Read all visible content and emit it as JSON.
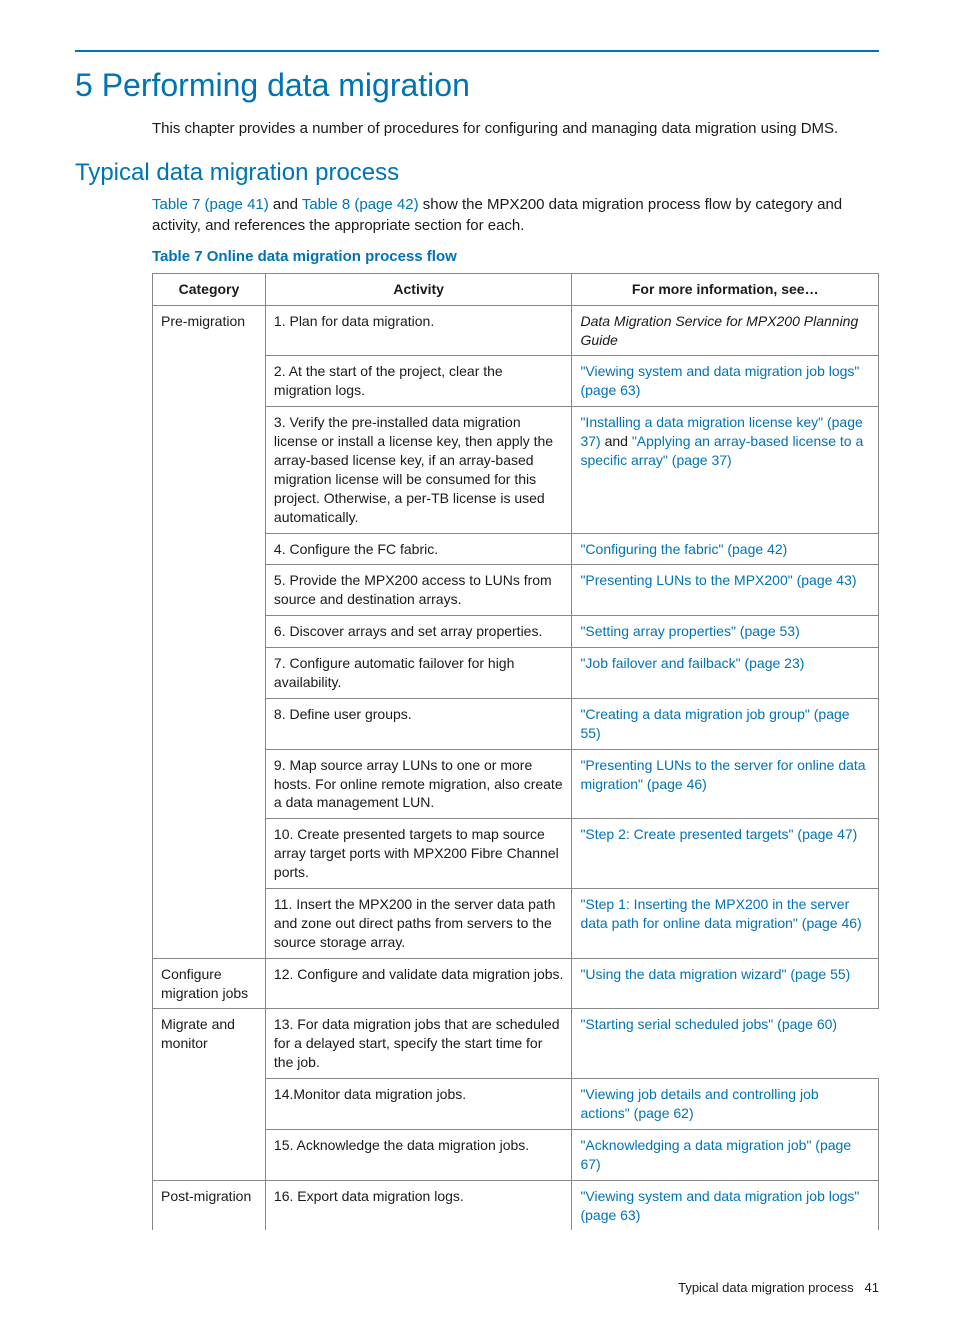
{
  "chapter_title": "5 Performing data migration",
  "chapter_intro": "This chapter provides a number of procedures for configuring and managing data migration using DMS.",
  "section_title": "Typical data migration process",
  "section_intro": {
    "link1": "Table 7 (page 41)",
    "mid1": " and ",
    "link2": "Table 8 (page 42)",
    "rest": " show the MPX200 data migration process flow by category and activity, and references the appropriate section for each."
  },
  "table_title": "Table 7 Online data migration process flow",
  "headers": {
    "c1": "Category",
    "c2": "Activity",
    "c3": "For more information, see…"
  },
  "rows": {
    "r1": {
      "cat": "Pre-migration",
      "act": "1. Plan for data migration.",
      "info_italic": "Data Migration Service for MPX200 Planning Guide"
    },
    "r2": {
      "act": "2. At the start of the project, clear the migration logs.",
      "link": "\"Viewing system and data migration job logs\" (page 63)"
    },
    "r3": {
      "act": "3. Verify the pre-installed data migration license or install a license key, then apply the array-based license key, if an array-based migration license will be consumed for this project. Otherwise, a per-TB license is used automatically.",
      "linkA": "\"Installing a data migration license key\" (page 37)",
      "mid": " and ",
      "linkB": "\"Applying an array-based license to a specific array\" (page 37)"
    },
    "r4": {
      "act": "4. Configure the FC fabric.",
      "link": "\"Configuring the fabric\" (page 42)"
    },
    "r5": {
      "act": "5. Provide the MPX200 access to LUNs from source and destination arrays.",
      "link": "\"Presenting LUNs to the MPX200\" (page 43)"
    },
    "r6": {
      "act": "6. Discover arrays and set array properties.",
      "link": "\"Setting array properties\" (page 53)"
    },
    "r7": {
      "act": "7. Configure automatic failover for high availability.",
      "link": "\"Job failover and failback\" (page 23)"
    },
    "r8": {
      "act": "8. Define user groups.",
      "link": "\"Creating a data migration job group\" (page 55)"
    },
    "r9": {
      "act": "9. Map source array LUNs to one or more hosts. For online remote migration, also create a data management LUN.",
      "link": "\"Presenting LUNs to the server for online data migration\" (page 46)"
    },
    "r10": {
      "act": "10. Create presented targets to map source array target ports with MPX200 Fibre Channel ports.",
      "link": "\"Step 2: Create presented targets\" (page 47)"
    },
    "r11": {
      "act": "11. Insert the MPX200 in the server data path and zone out direct paths from servers to the source storage array.",
      "link": "\"Step 1: Inserting the MPX200 in the server data path for online data migration\" (page 46)"
    },
    "r12": {
      "cat": "Configure migration jobs",
      "act": "12. Configure and validate data migration jobs.",
      "link": "\"Using the data migration wizard\" (page 55)"
    },
    "r13": {
      "cat": "Migrate and monitor",
      "act": "13. For data migration jobs that are scheduled for a delayed start, specify the start time for the job.",
      "link": "\"Starting serial scheduled jobs\" (page 60)"
    },
    "r14": {
      "act": "14.Monitor data migration jobs.",
      "link": "\"Viewing job details and controlling job actions\" (page 62)"
    },
    "r15": {
      "act": "15. Acknowledge the data migration jobs.",
      "link": "\"Acknowledging a data migration job\" (page 67)"
    },
    "r16": {
      "cat": "Post-migration",
      "act": "16. Export data migration logs.",
      "link": "\"Viewing system and data migration job logs\" (page 63)"
    }
  },
  "footer": {
    "text": "Typical data migration process",
    "page": "41"
  }
}
